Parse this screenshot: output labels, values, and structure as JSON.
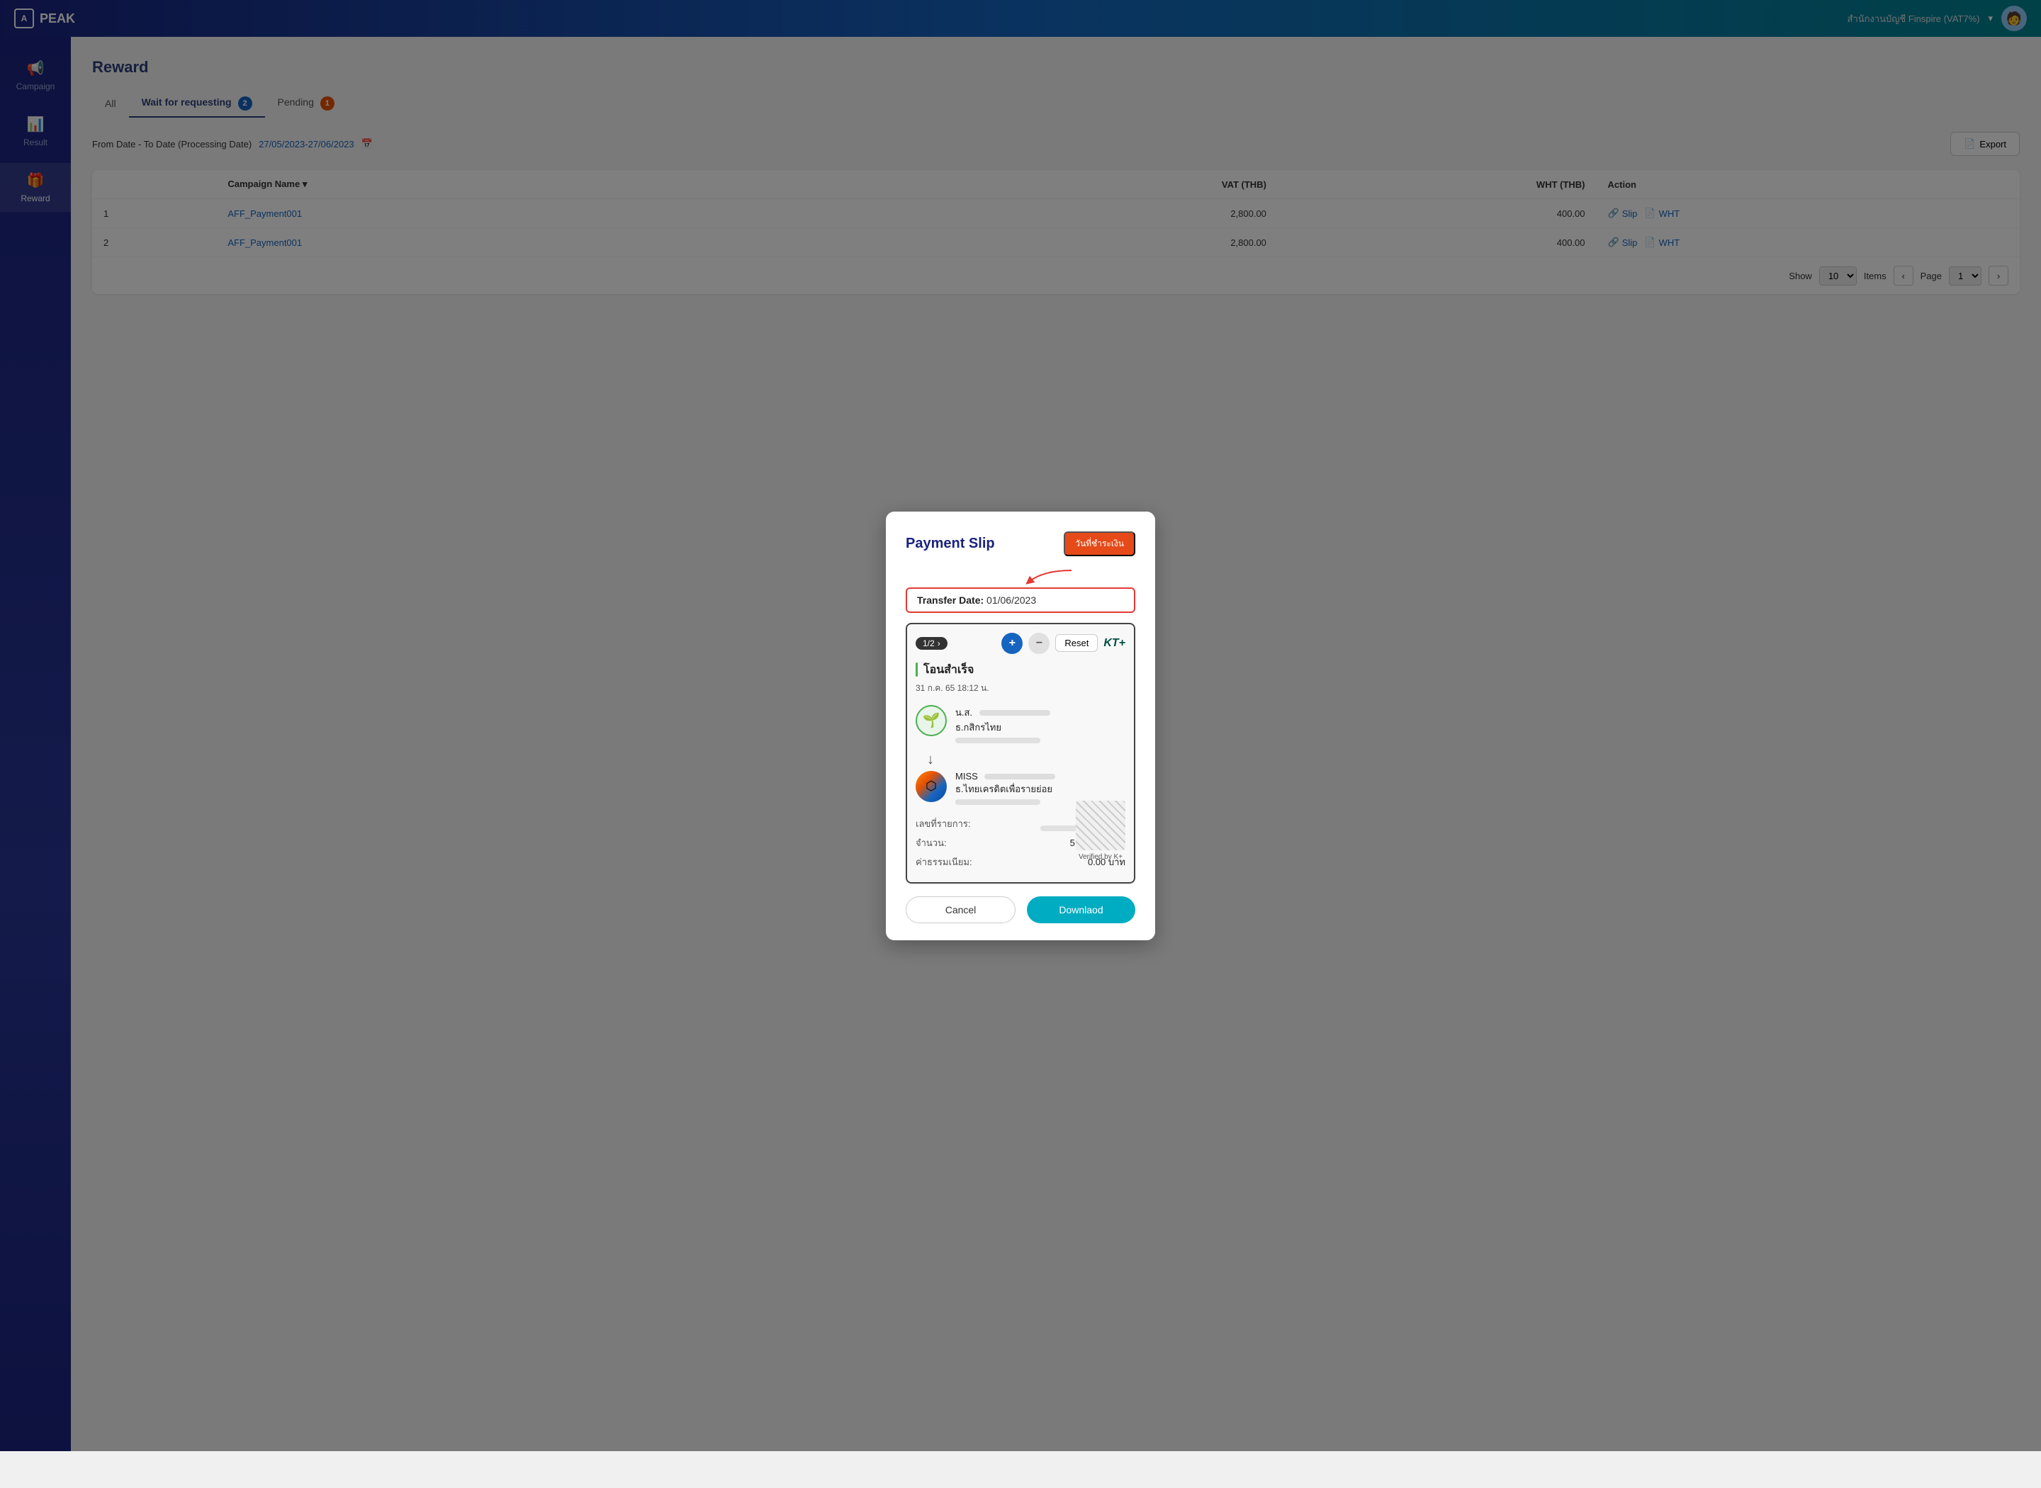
{
  "topnav": {
    "logo_text": "PEAK",
    "company": "สำนักงานบัญชี Finspire (VAT7%)",
    "chevron": "▾"
  },
  "sidebar": {
    "items": [
      {
        "id": "campaign",
        "icon": "📢",
        "label": "Campaign"
      },
      {
        "id": "result",
        "icon": "📊",
        "label": "Result"
      },
      {
        "id": "reward",
        "icon": "🎁",
        "label": "Reward",
        "active": true
      }
    ]
  },
  "page": {
    "title": "Reward"
  },
  "tabs": [
    {
      "id": "all",
      "label": "All",
      "badge": null
    },
    {
      "id": "wait",
      "label": "Wait for requesting",
      "badge": "2",
      "badge_color": "blue"
    },
    {
      "id": "pending",
      "label": "Pending",
      "badge": "1",
      "badge_color": "orange"
    }
  ],
  "filter": {
    "date_label": "From Date - To Date (Processing Date)",
    "date_value": "27/05/2023-27/06/2023",
    "calendar_icon": "📅"
  },
  "export_btn": "Export",
  "table": {
    "headers": [
      "",
      "Campaign Name",
      "",
      "",
      "",
      "VAT (THB)",
      "WHT (THB)",
      "Action"
    ],
    "rows": [
      {
        "num": "1",
        "campaign": "AFF_Payment001",
        "vat": "2,800.00",
        "wht": "400.00",
        "slip_label": "Slip",
        "wht_label": "WHT"
      },
      {
        "num": "2",
        "campaign": "AFF_Payment001",
        "vat": "2,800.00",
        "wht": "400.00",
        "slip_label": "Slip",
        "wht_label": "WHT"
      }
    ]
  },
  "pagination": {
    "show_label": "Show",
    "items_label": "Items",
    "page_label": "Page",
    "items_per_page": "10",
    "current_page": "1"
  },
  "modal": {
    "title": "Payment Slip",
    "tag_btn": "วันที่ชำระเงิน",
    "transfer_date_label": "Transfer Date:",
    "transfer_date_value": "01/06/2023",
    "slip_nav": {
      "page_indicator": "1/2",
      "next_icon": "›",
      "plus_icon": "+",
      "minus_icon": "−",
      "reset_label": "Reset"
    },
    "bank_kt_logo": "KT+",
    "slip": {
      "status_text": "โอนสำเร็จ",
      "datetime": "31 ก.ค. 65  18:12 น.",
      "sender_name_prefix": "น.ส.",
      "sender_bank": "ธ.กสิกรไทย",
      "arrow": "↓",
      "receiver_prefix": "MISS",
      "receiver_bank": "ธ.ไทยเครดิตเพื่อรายย่อย",
      "detail_label1": "เลขที่รายการ:",
      "detail_label2": "จำนวน:",
      "detail_value2": "5,000.00 บาท",
      "detail_label3": "ค่าธรรมเนียม:",
      "detail_value3": "0.00 บาท",
      "qr_label": "Verified by K+"
    },
    "cancel_btn": "Cancel",
    "download_btn": "Downlaod"
  }
}
